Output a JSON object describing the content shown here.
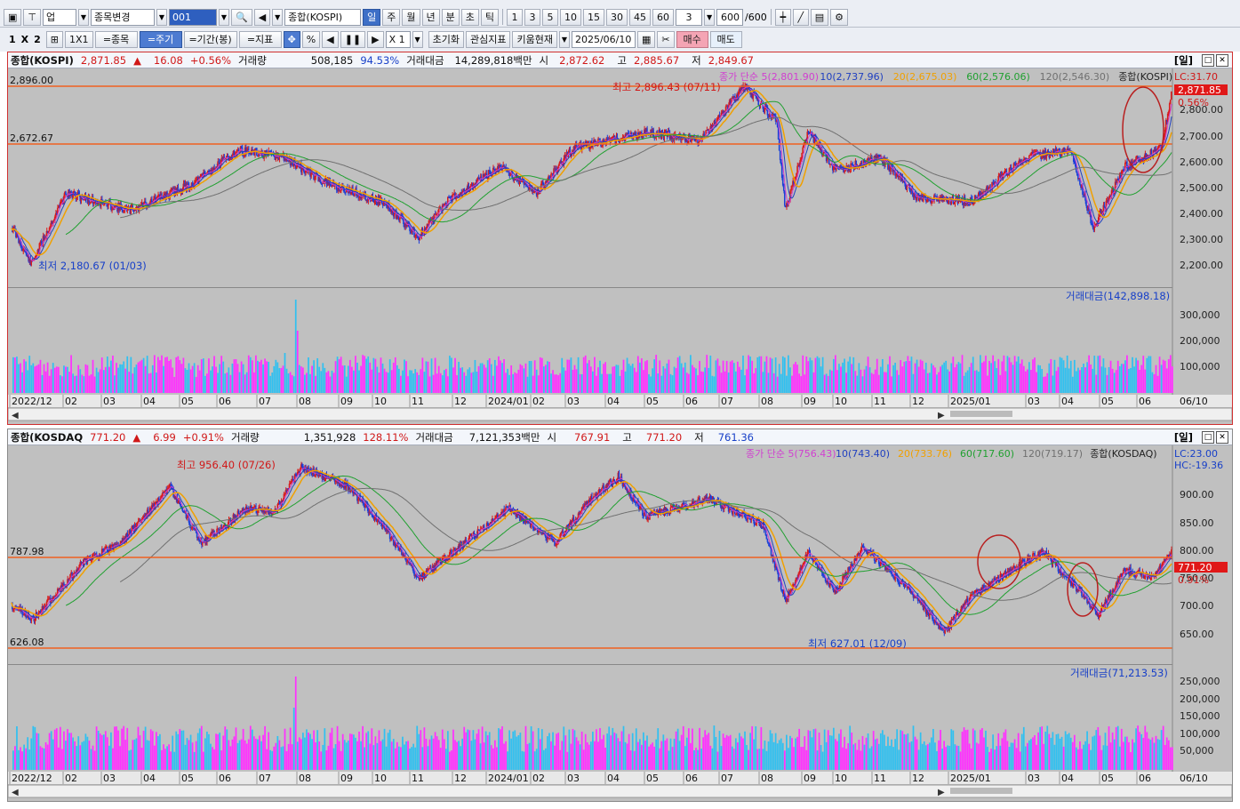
{
  "toolbar1": {
    "items": [
      "업",
      "종목변경",
      "001",
      "종합(KOSPI)"
    ],
    "periods": [
      "일",
      "주",
      "월",
      "년",
      "분",
      "초",
      "틱"
    ],
    "numbers": [
      "1",
      "3",
      "5",
      "10",
      "15",
      "30",
      "45",
      "60"
    ],
    "interval_value": "3",
    "count_value": "600",
    "count_total": "/600"
  },
  "toolbar2": {
    "layout_labels": [
      "1",
      "X",
      "2"
    ],
    "grid_label": "1X1",
    "buttons": [
      "=종목",
      "=주기",
      "=기간(봉)",
      "=지표"
    ],
    "zoom_value": "X 1",
    "reset_label": "초기화",
    "indicator_label": "관심지표",
    "kiwoom_label": "키움현재",
    "date_value": "2025/06/10",
    "buy_label": "매수",
    "sell_label": "매도"
  },
  "panel_top": {
    "name": "종합(KOSPI)",
    "price": "2,871.85",
    "arrow": "▲",
    "change": "16.08",
    "change_pct": "+0.56%",
    "volume_label": "거래량",
    "volume": "508,185",
    "volume_pct": "94.53%",
    "amount_label": "거래대금",
    "amount": "14,289,818백만",
    "open_label": "시",
    "open": "2,872.62",
    "high_label": "고",
    "high": "2,885.67",
    "low_label": "저",
    "low": "2,849.67",
    "period_label": "[일]",
    "ma_legend": [
      "종가 단순 5(2,801.90)",
      "10(2,737.96)",
      "20(2,675.03)",
      "60(2,576.06)",
      "120(2,546.30)",
      "종합(KOSPI)"
    ],
    "lc_label": "LC:31.70",
    "last_price_label": "2,871.85",
    "last_pct_label": "0.56%",
    "hline_labels": [
      "2,896.00",
      "2,672.67"
    ],
    "high_annot": "최고 2,896.43 (07/11)",
    "low_annot": "최저 2,180.67 (01/03)",
    "y_ticks": [
      "2,800.00",
      "2,700.00",
      "2,600.00",
      "2,500.00",
      "2,400.00",
      "2,300.00",
      "2,200.00"
    ],
    "vol_legend": "거래대금(142,898.18)",
    "vol_ticks": [
      "300,000",
      "200,000",
      "100,000"
    ],
    "x_ticks": [
      "2022/12",
      "02",
      "03",
      "04",
      "05",
      "06",
      "07",
      "08",
      "09",
      "10",
      "11",
      "12",
      "2024/01",
      "02",
      "03",
      "04",
      "05",
      "06",
      "07",
      "08",
      "09",
      "10",
      "11",
      "12",
      "2025/01",
      "03",
      "04",
      "05",
      "06"
    ],
    "last_date": "06/10"
  },
  "panel_bot": {
    "name": "종합(KOSDAQ",
    "price": "771.20",
    "arrow": "▲",
    "change": "6.99",
    "change_pct": "+0.91%",
    "volume_label": "거래량",
    "volume": "1,351,928",
    "volume_pct": "128.11%",
    "amount_label": "거래대금",
    "amount": "7,121,353백만",
    "open_label": "시",
    "open": "767.91",
    "high_label": "고",
    "high": "771.20",
    "low_label": "저",
    "low": "761.36",
    "period_label": "[일]",
    "ma_legend": [
      "종가 단순 5(756.43)",
      "10(743.40)",
      "20(733.76)",
      "60(717.60)",
      "120(719.17)",
      "종합(KOSDAQ)"
    ],
    "hc_label": "HC:-19.36",
    "lc_label": "LC:23.00",
    "last_price_label": "771.20",
    "last_pct_label": "0.91%",
    "hline_labels": [
      "787.98",
      "626.08"
    ],
    "high_annot": "최고 956.40 (07/26)",
    "low_annot": "최저 627.01 (12/09)",
    "y_ticks": [
      "900.00",
      "850.00",
      "800.00",
      "750.00",
      "700.00",
      "650.00"
    ],
    "vol_legend": "거래대금(71,213.53)",
    "vol_ticks": [
      "250,000",
      "200,000",
      "150,000",
      "100,000",
      "50,000"
    ],
    "x_ticks": [
      "2022/12",
      "02",
      "03",
      "04",
      "05",
      "06",
      "07",
      "08",
      "09",
      "10",
      "11",
      "12",
      "2024/01",
      "02",
      "03",
      "04",
      "05",
      "06",
      "07",
      "08",
      "09",
      "10",
      "11",
      "12",
      "2025/01",
      "03",
      "04",
      "05",
      "06"
    ],
    "last_date": "06/10"
  },
  "colors": {
    "up": "#d81b1b",
    "down": "#1b3fd8",
    "ma5": "#d040d0",
    "ma10": "#2040c0",
    "ma20": "#f0a000",
    "ma60": "#20a030",
    "ma120": "#707070",
    "hline": "#f06020",
    "vol_up": "#ff30ff",
    "vol_down": "#30c0f0",
    "bg": "#c0c0c0"
  }
}
